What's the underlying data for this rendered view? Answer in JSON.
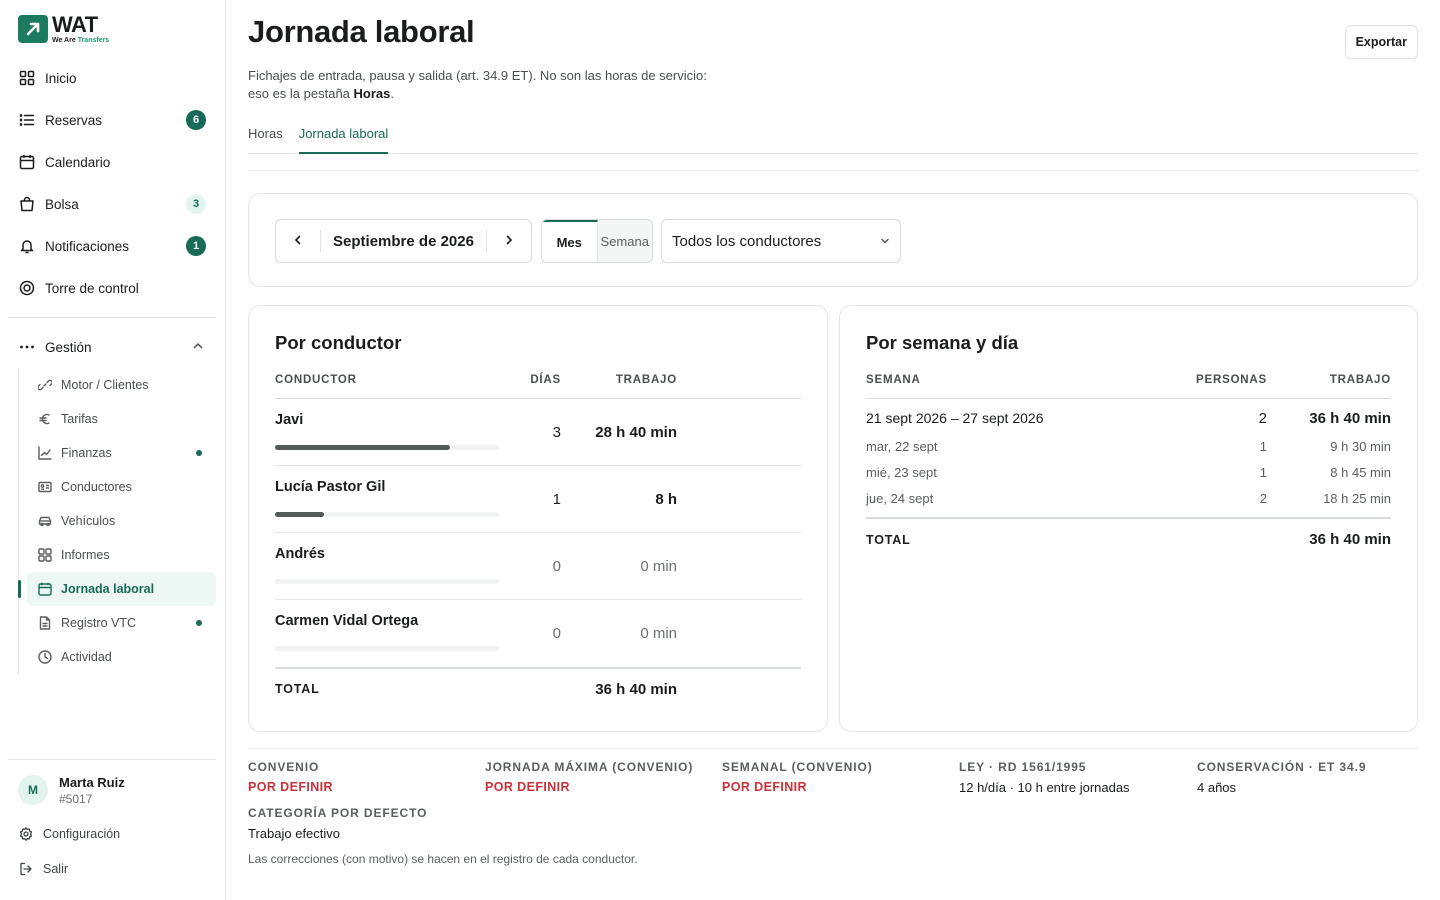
{
  "brand": {
    "name": "WAT",
    "tagline_a": "We Are ",
    "tagline_b": "Transfers",
    "accent": "#186b57"
  },
  "nav": {
    "items": [
      {
        "label": "Inicio",
        "icon": "grid-icon"
      },
      {
        "label": "Reservas",
        "icon": "list-icon",
        "badge": "6"
      },
      {
        "label": "Calendario",
        "icon": "calendar-icon"
      },
      {
        "label": "Bolsa",
        "icon": "bag-icon",
        "badge": "3"
      },
      {
        "label": "Notificaciones",
        "icon": "bell-icon",
        "badge": "1"
      },
      {
        "label": "Torre de control",
        "icon": "target-icon"
      }
    ],
    "group_label": "Gestión",
    "sub_items": [
      {
        "label": "Motor / Clientes",
        "icon": "link-icon"
      },
      {
        "label": "Tarifas",
        "icon": "euro-icon"
      },
      {
        "label": "Finanzas",
        "icon": "chart-line-icon"
      },
      {
        "label": "Conductores",
        "icon": "id-card-icon"
      },
      {
        "label": "Vehículos",
        "icon": "car-icon"
      },
      {
        "label": "Informes",
        "icon": "grid-icon"
      },
      {
        "label": "Jornada laboral",
        "icon": "calendar-icon"
      },
      {
        "label": "Registro VTC",
        "icon": "document-icon"
      },
      {
        "label": "Actividad",
        "icon": "clock-icon"
      }
    ]
  },
  "user": {
    "initial": "M",
    "name": "Marta Ruiz",
    "id": "#5017"
  },
  "footer": {
    "settings": "Configuración",
    "logout": "Salir"
  },
  "page": {
    "title": "Jornada laboral",
    "subtitle_pre": "Fichajes de entrada, pausa y salida (art. 34.9 ET). No son las horas de servicio: eso es la pestaña ",
    "subtitle_bold": "Horas",
    "subtitle_post": ".",
    "export_label": "Exportar",
    "tabs": [
      "Horas",
      "Jornada laboral"
    ]
  },
  "filters": {
    "period": "Septiembre de 2026",
    "mode_month": "Mes",
    "mode_week": "Semana",
    "driver_select": "Todos los conductores"
  },
  "by_driver": {
    "title": "Por conductor",
    "headers": {
      "driver": "CONDUCTOR",
      "days": "DÍAS",
      "work": "TRABAJO"
    },
    "rows": [
      {
        "name": "Javi",
        "days": "3",
        "work": "28 h 40 min",
        "share": 0.78
      },
      {
        "name": "Lucía Pastor Gil",
        "days": "1",
        "work": "8 h",
        "share": 0.22
      },
      {
        "name": "Andrés",
        "days": "0",
        "work": "0 min",
        "share": 0
      },
      {
        "name": "Carmen Vidal Ortega",
        "days": "0",
        "work": "0 min",
        "share": 0
      }
    ],
    "total_label": "TOTAL",
    "total": "36 h 40 min"
  },
  "by_week": {
    "title": "Por semana y día",
    "headers": {
      "week": "SEMANA",
      "people": "PERSONAS",
      "work": "TRABAJO"
    },
    "week": {
      "range": "21 sept 2026 – 27 sept 2026",
      "people": "2",
      "work": "36 h 40 min"
    },
    "days": [
      {
        "day": "mar, 22 sept",
        "people": "1",
        "work": "9 h 30 min"
      },
      {
        "day": "mié, 23 sept",
        "people": "1",
        "work": "8 h 45 min"
      },
      {
        "day": "jue, 24 sept",
        "people": "2",
        "work": "18 h 25 min"
      }
    ],
    "total_label": "TOTAL",
    "total": "36 h 40 min"
  },
  "specs": [
    {
      "key": "CONVENIO",
      "value": "POR DEFINIR",
      "warn": true
    },
    {
      "key": "JORNADA MÁXIMA (CONVENIO)",
      "value": "POR DEFINIR",
      "warn": true
    },
    {
      "key": "SEMANAL (CONVENIO)",
      "value": "POR DEFINIR",
      "warn": true
    },
    {
      "key": "LEY · RD 1561/1995",
      "value": "12 h/día · 10 h entre jornadas",
      "warn": false
    },
    {
      "key": "CONSERVACIÓN · ET 34.9",
      "value": "4 años",
      "warn": false
    },
    {
      "key": "CATEGORÍA POR DEFECTO",
      "value": "Trabajo efectivo",
      "warn": false
    }
  ],
  "note": "Las correcciones (con motivo) se hacen en el registro de cada conductor."
}
